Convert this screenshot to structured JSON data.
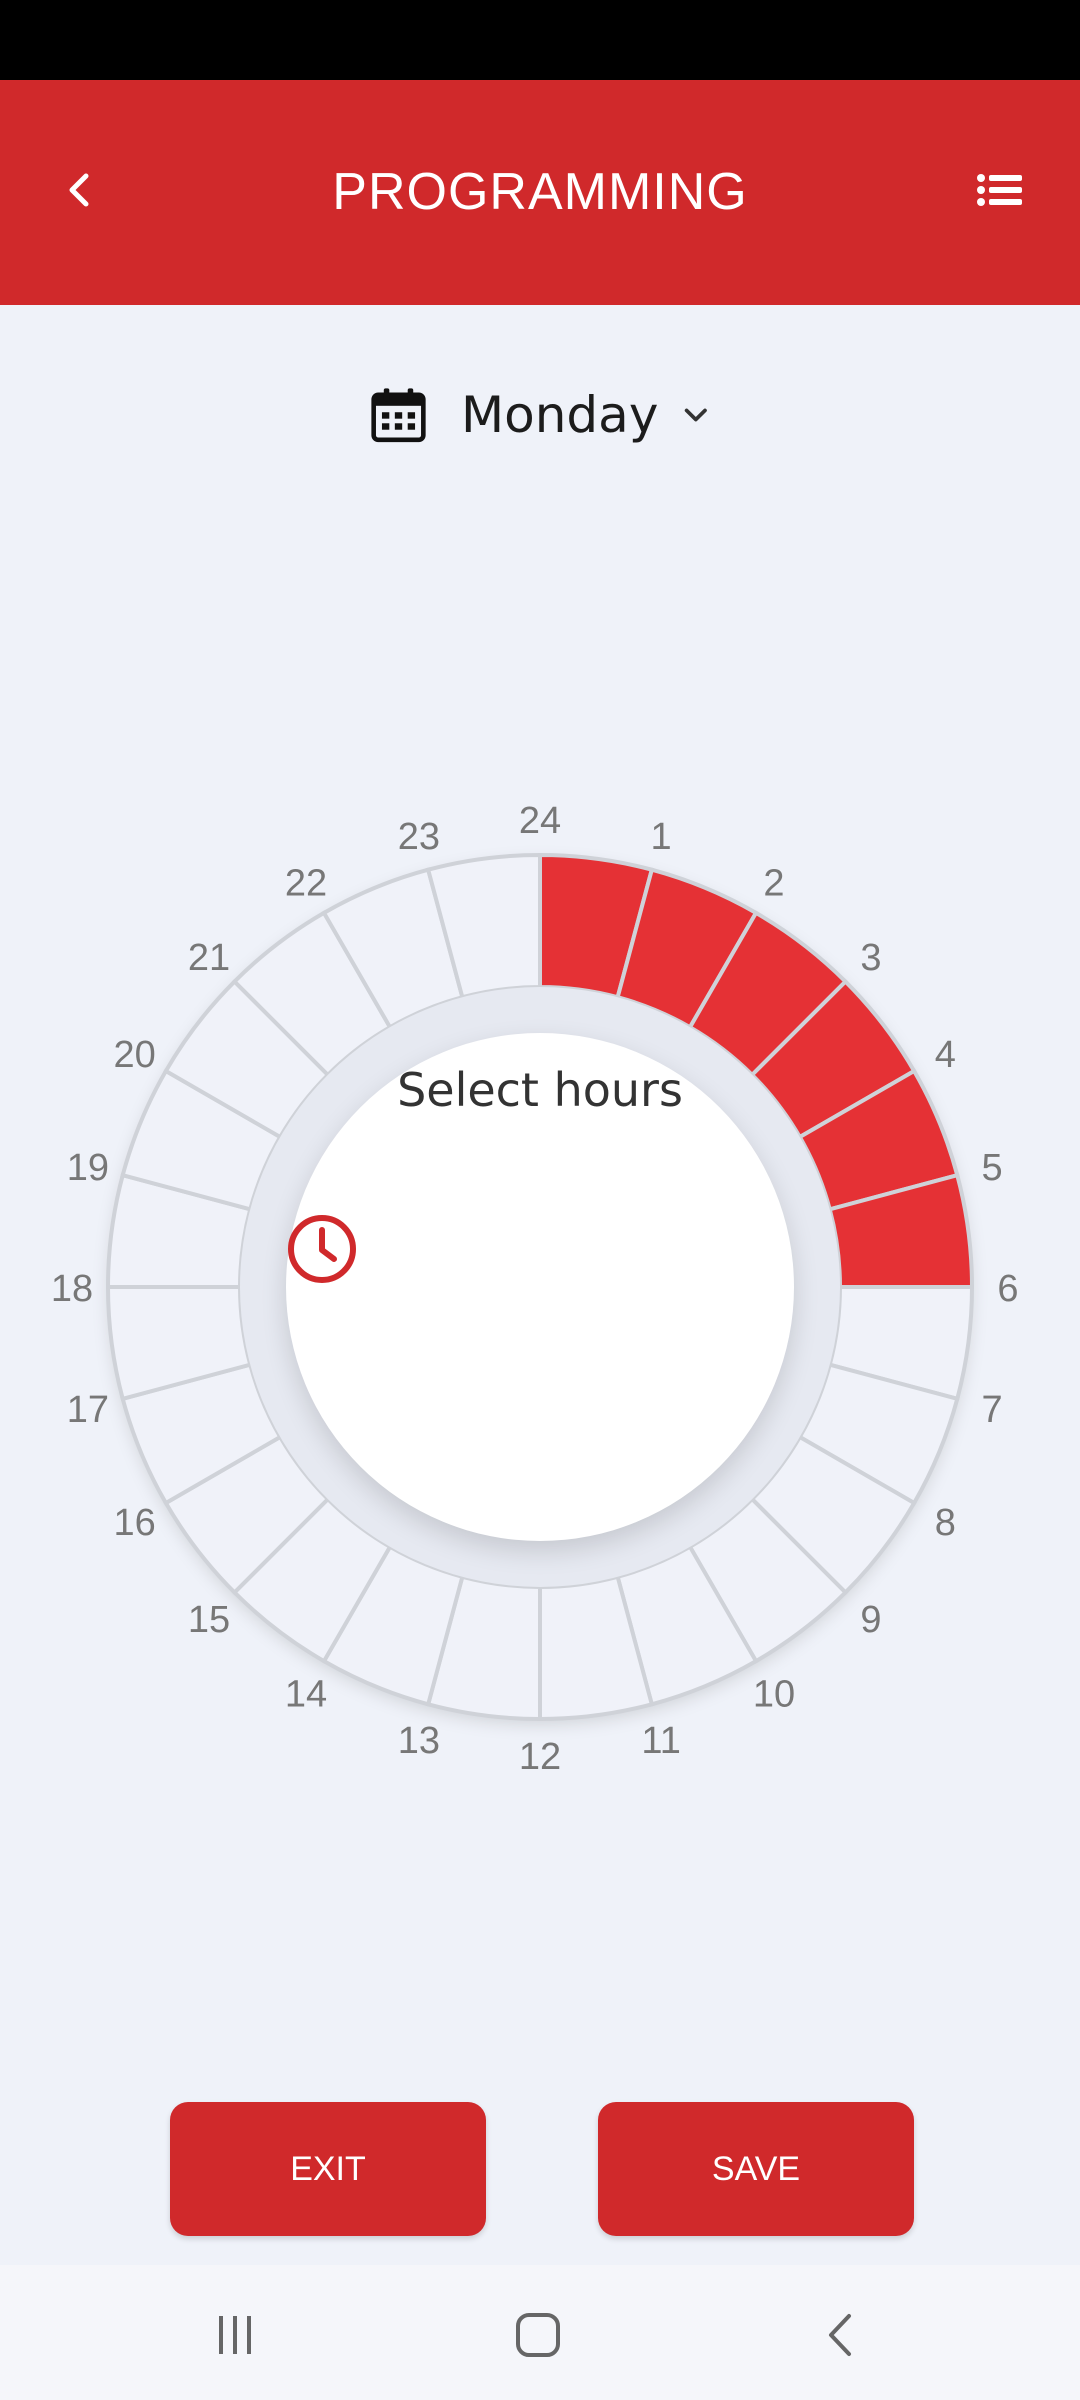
{
  "header": {
    "title": "PROGRAMMING",
    "back_icon": "chevron-left-icon",
    "menu_icon": "list-icon"
  },
  "day_selector": {
    "value": "Monday",
    "icon": "calendar-icon",
    "dropdown_icon": "chevron-down-icon"
  },
  "dial": {
    "center_label": "Select hours",
    "center_icon": "clock-icon",
    "hour_labels": [
      "1",
      "2",
      "3",
      "4",
      "5",
      "6",
      "7",
      "8",
      "9",
      "10",
      "11",
      "12",
      "13",
      "14",
      "15",
      "16",
      "17",
      "18",
      "19",
      "20",
      "21",
      "22",
      "23",
      "24"
    ],
    "selected_hours": [
      1,
      2,
      3,
      4,
      5,
      6
    ],
    "selected_color": "#e53135",
    "unselected_color": "#f0f2f9"
  },
  "actions": {
    "exit_label": "EXIT",
    "save_label": "SAVE"
  },
  "colors": {
    "brand": "#d0292b",
    "background": "#eff2f9"
  }
}
